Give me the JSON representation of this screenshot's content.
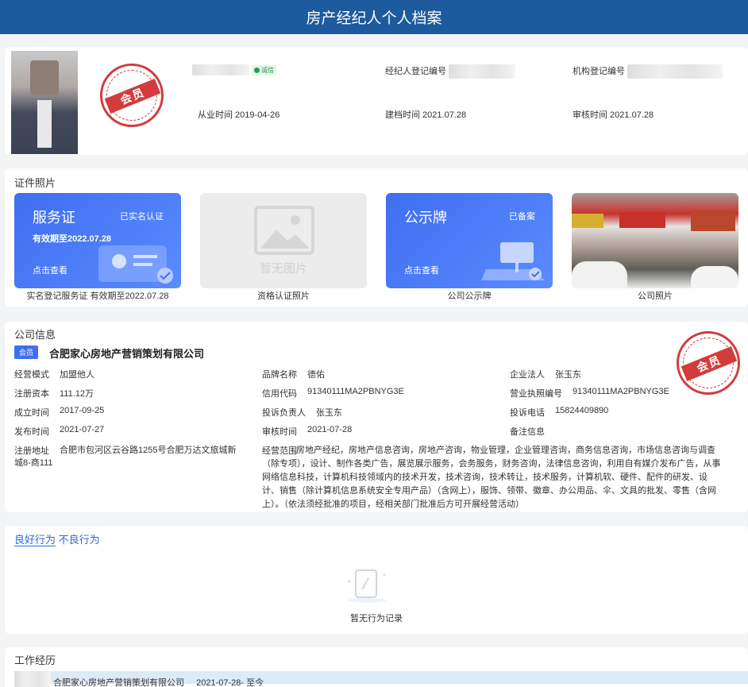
{
  "header": {
    "title": "房产经纪人个人档案"
  },
  "profile": {
    "cert_badge": "诚信",
    "stamp_text": "会员",
    "agent_reg_label": "经纪人登记编号",
    "org_reg_label": "机构登记编号",
    "work_since": "从业时间 2019-04-26",
    "archived": "建档时间 2021.07.28",
    "reviewed": "审核时间 2021.07.28"
  },
  "certs": {
    "title": "证件照片",
    "tiles": [
      {
        "big": "服务证",
        "tag": "已实名认证",
        "expiry": "有效期至2022.07.28",
        "view": "点击查看",
        "caption": "实名登记服务证 有效期至2022.07.28"
      },
      {
        "placeholder": "暂无图片",
        "caption": "资格认证照片"
      },
      {
        "big": "公示牌",
        "tag": "已备案",
        "view": "点击查看",
        "caption": "公司公示牌"
      },
      {
        "caption": "公司照片"
      }
    ]
  },
  "company": {
    "title": "公司信息",
    "member_tag": "会员",
    "name": "合肥家心房地产营销策划有限公司",
    "stamp_text": "会员",
    "fields": {
      "mode_l": "经营模式",
      "mode_v": "加盟他人",
      "brand_l": "品牌名称",
      "brand_v": "德佑",
      "legal_l": "企业法人",
      "legal_v": "张玉东",
      "capital_l": "注册资本",
      "capital_v": "111.12万",
      "credit_l": "信用代码",
      "credit_v": "91340111MA2PBNYG3E",
      "license_l": "营业执照编号",
      "license_v": "91340111MA2PBNYG3E",
      "founded_l": "成立时间",
      "founded_v": "2017-09-25",
      "complaint_p_l": "投诉负责人",
      "complaint_p_v": "张玉东",
      "complaint_t_l": "投诉电话",
      "complaint_t_v": "15824409890",
      "published_l": "发布时间",
      "published_v": "2021-07-27",
      "reviewed_l": "审核时间",
      "reviewed_v": "2021-07-28",
      "remark_l": "备注信息",
      "address_l": "注册地址",
      "address_v": "合肥市包河区云谷路1255号合肥万达文旅城新城8-商111",
      "scope_l": "经营范围",
      "scope_v": "房地产经纪，房地产信息咨询，房地产咨询，物业管理，企业管理咨询，商务信息咨询，市场信息咨询与调查（除专项），设计、制作各类广告，展览展示服务，会务服务，财务咨询，法律信息咨询，利用自有媒介发布广告，从事网络信息科技，计算机科技领域内的技术开发，技术咨询，技术转让，技术服务，计算机软、硬件、配件的研发、设计、销售（除计算机信息系统安全专用产品）（含网上），服饰、领带、徽章、办公用品、伞、文具的批发、零售（含网上）。（依法须经批准的项目，经相关部门批准后方可开展经营活动）"
    }
  },
  "behavior": {
    "tab_good": "良好行为",
    "tab_bad": "不良行为",
    "empty": "暂无行为记录"
  },
  "work": {
    "title": "工作经历",
    "company": "合肥家心房地产营销策划有限公司",
    "period": "2021-07-28- 至今"
  }
}
